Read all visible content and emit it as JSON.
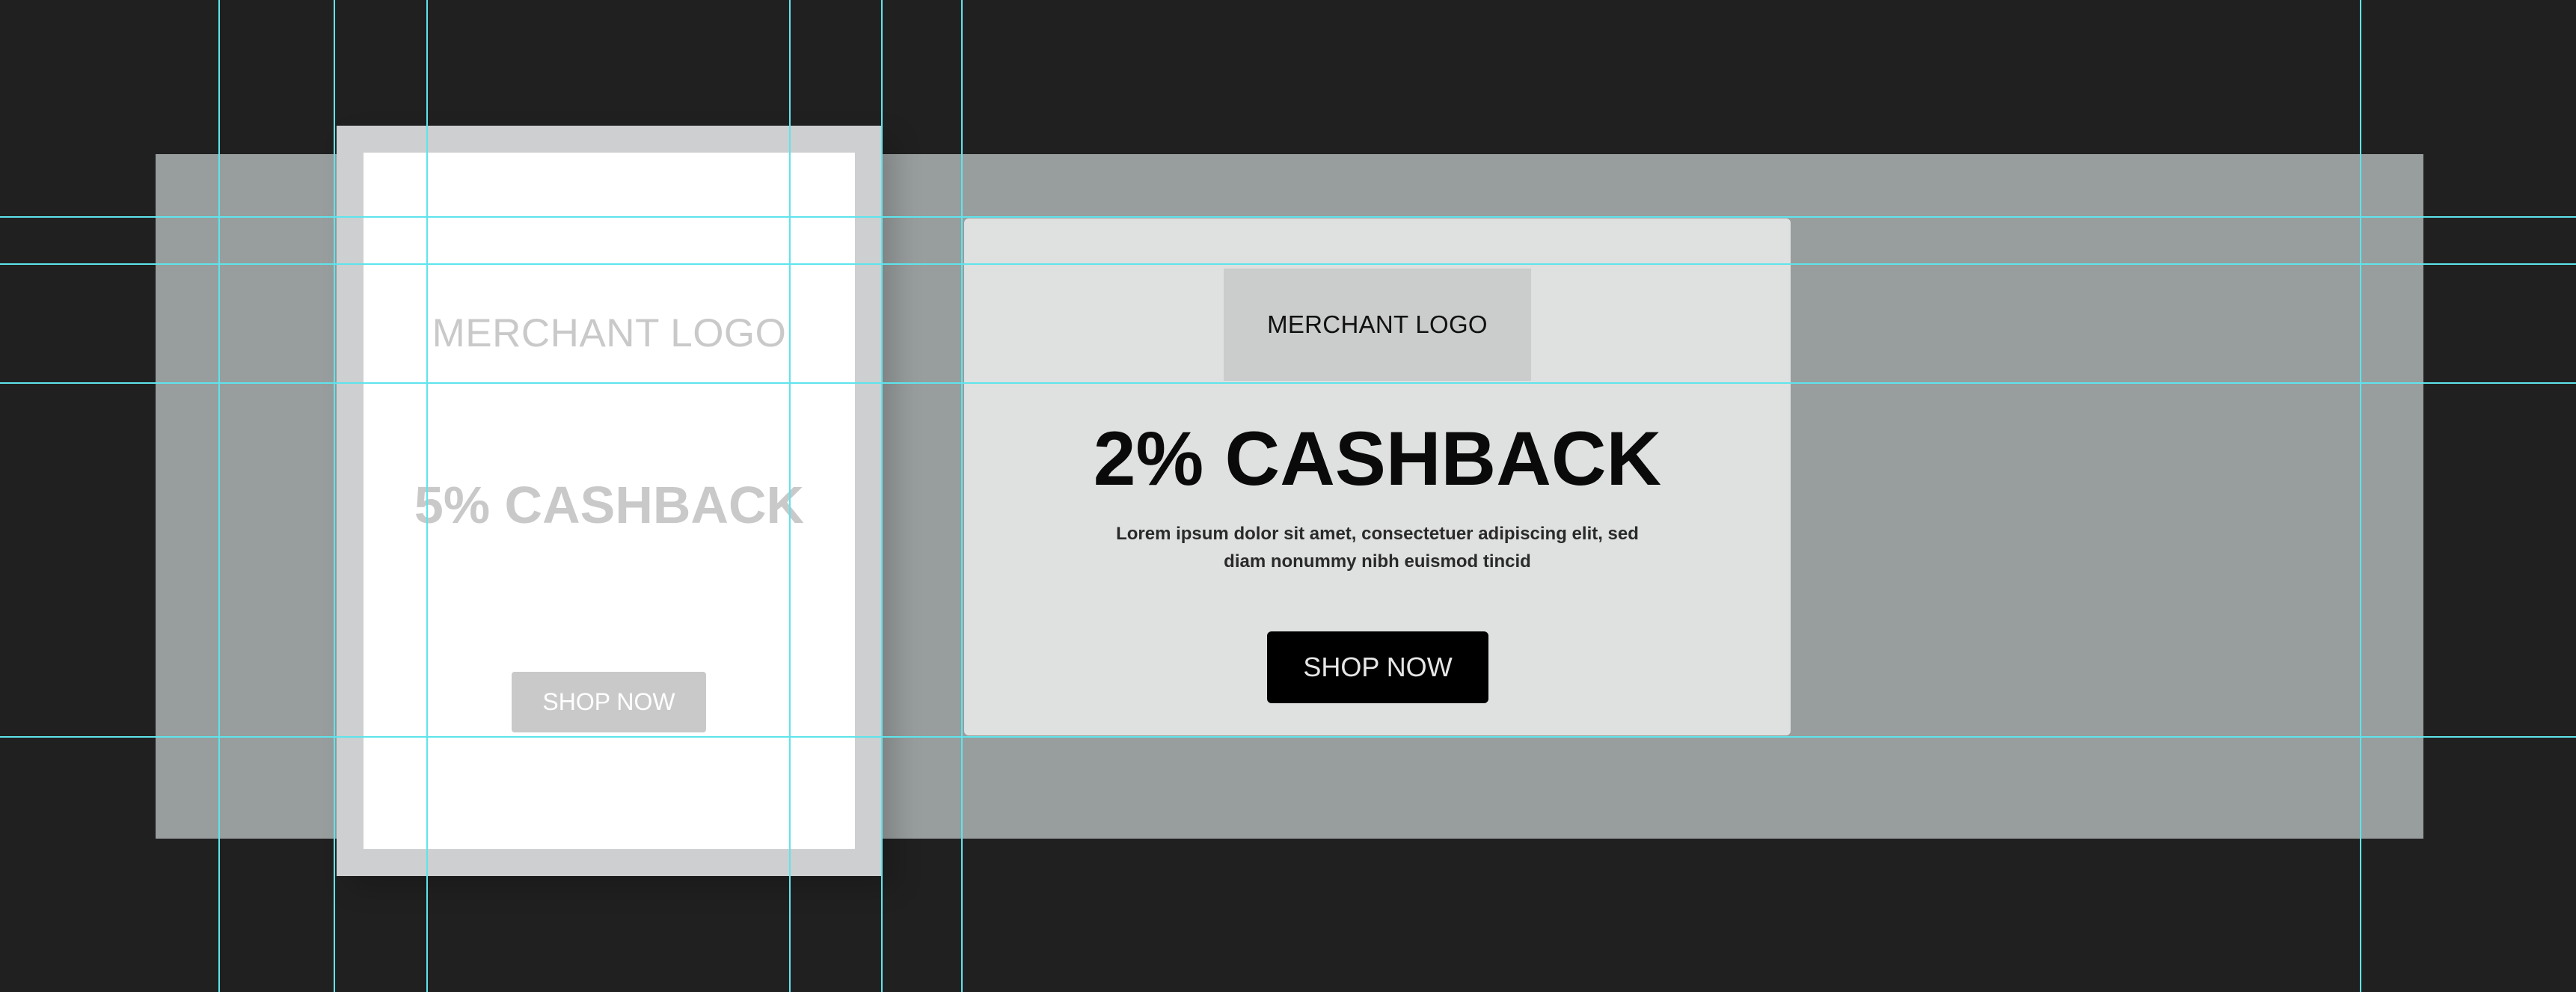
{
  "mobile_banner": {
    "logo_text": "MERCHANT LOGO",
    "cashback_text": "5% CASHBACK",
    "shop_button_label": "SHOP NOW"
  },
  "desktop_banner": {
    "logo_text": "MERCHANT LOGO",
    "cashback_text": "2% CASHBACK",
    "description": "Lorem ipsum dolor sit amet, consectetuer adipiscing elit, sed diam nonummy nibh euismod tincid",
    "shop_button_label": "SHOP NOW"
  },
  "colors": {
    "canvas_background": "#202020",
    "backdrop": "#989d9d",
    "guide": "#5ee4ec",
    "button_primary": "#000000",
    "button_inactive": "#c9c9c9"
  }
}
